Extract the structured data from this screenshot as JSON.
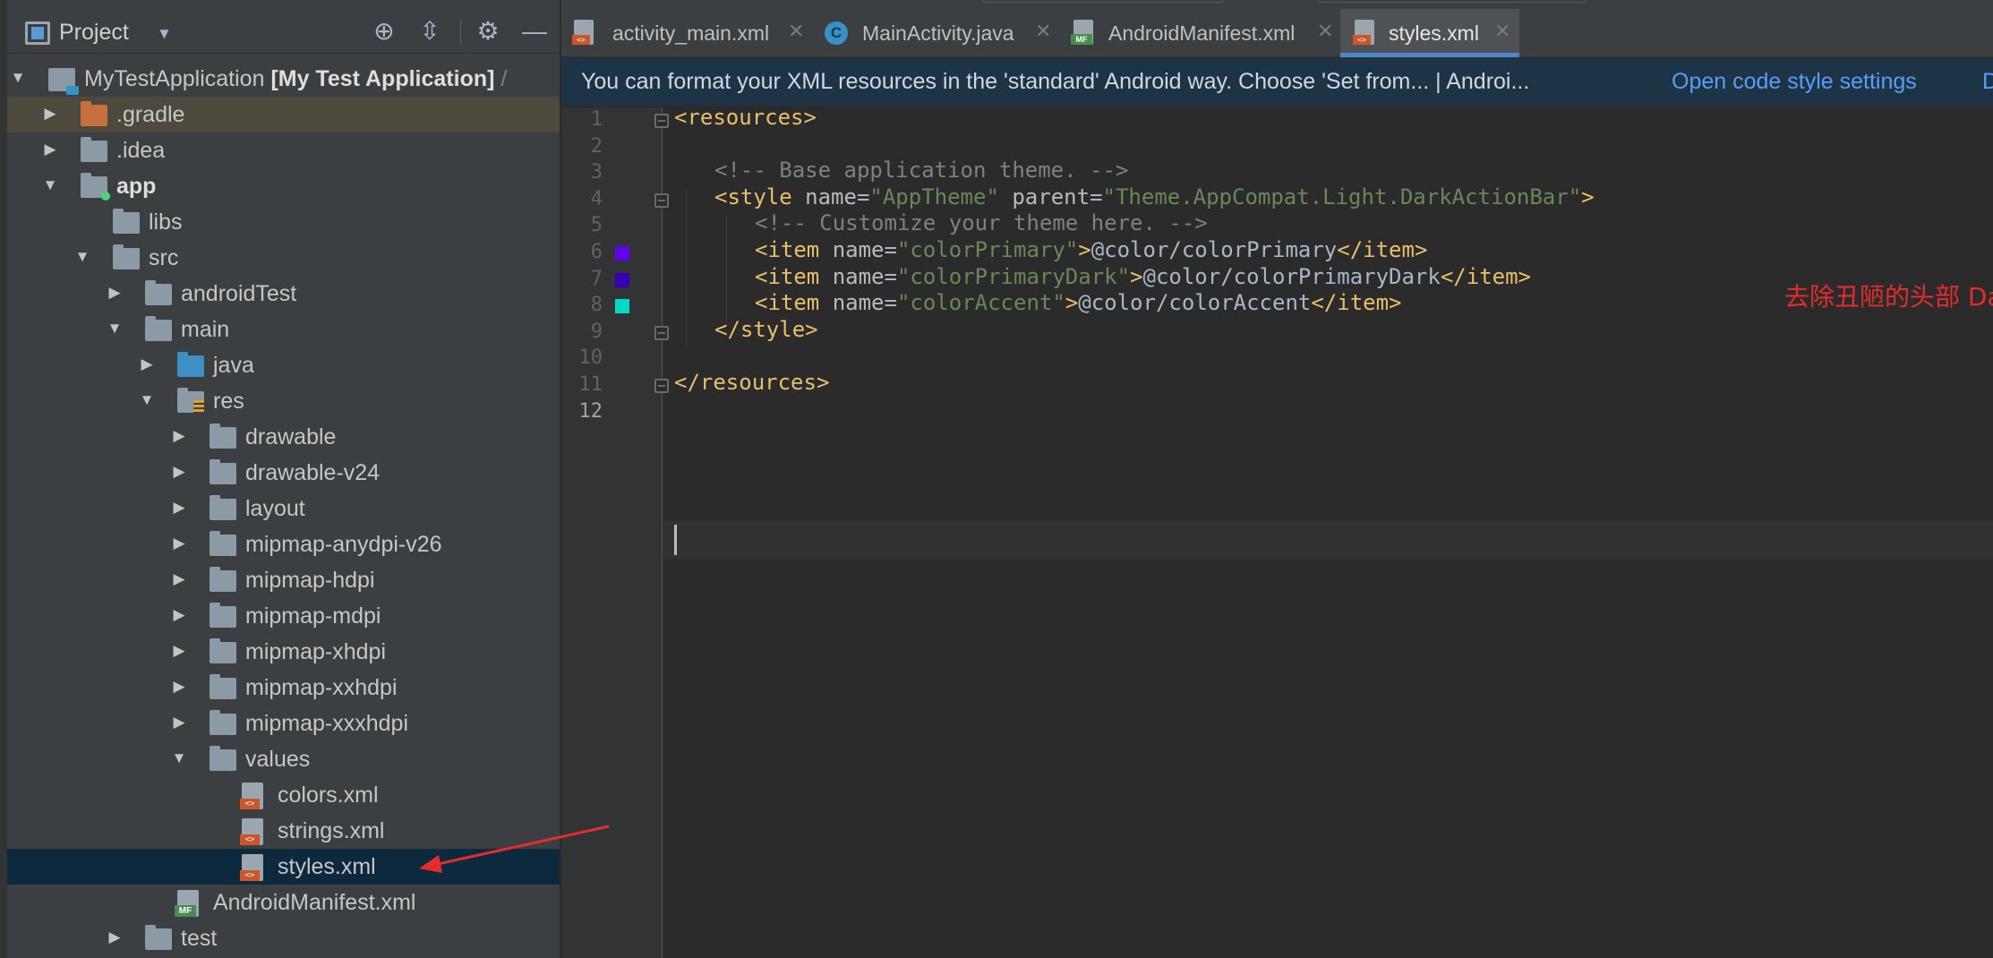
{
  "project_panel": {
    "title": "Project",
    "icons": [
      "locate-icon",
      "collapse-icon",
      "gear-icon",
      "minimize-icon"
    ]
  },
  "tree": [
    {
      "label": "MyTestApplication",
      "extra": "[My Test Application]",
      "suffix": "/",
      "type": "module",
      "indent": 0,
      "expanded": true
    },
    {
      "label": ".gradle",
      "type": "folder-orange",
      "indent": 1,
      "expanded": false
    },
    {
      "label": ".idea",
      "type": "folder",
      "indent": 1,
      "expanded": false
    },
    {
      "label": "app",
      "type": "folder-app",
      "indent": 1,
      "expanded": true
    },
    {
      "label": "libs",
      "type": "folder",
      "indent": 2
    },
    {
      "label": "src",
      "type": "folder",
      "indent": 2,
      "expanded": true
    },
    {
      "label": "androidTest",
      "type": "folder",
      "indent": 3,
      "expanded": false
    },
    {
      "label": "main",
      "type": "folder",
      "indent": 3,
      "expanded": true
    },
    {
      "label": "java",
      "type": "folder-blue",
      "indent": 4,
      "expanded": false
    },
    {
      "label": "res",
      "type": "folder-res",
      "indent": 4,
      "expanded": true
    },
    {
      "label": "drawable",
      "type": "folder",
      "indent": 5,
      "expanded": false
    },
    {
      "label": "drawable-v24",
      "type": "folder",
      "indent": 5,
      "expanded": false
    },
    {
      "label": "layout",
      "type": "folder",
      "indent": 5,
      "expanded": false
    },
    {
      "label": "mipmap-anydpi-v26",
      "type": "folder",
      "indent": 5,
      "expanded": false
    },
    {
      "label": "mipmap-hdpi",
      "type": "folder",
      "indent": 5,
      "expanded": false
    },
    {
      "label": "mipmap-mdpi",
      "type": "folder",
      "indent": 5,
      "expanded": false
    },
    {
      "label": "mipmap-xhdpi",
      "type": "folder",
      "indent": 5,
      "expanded": false
    },
    {
      "label": "mipmap-xxhdpi",
      "type": "folder",
      "indent": 5,
      "expanded": false
    },
    {
      "label": "mipmap-xxxhdpi",
      "type": "folder",
      "indent": 5,
      "expanded": false
    },
    {
      "label": "values",
      "type": "folder",
      "indent": 5,
      "expanded": true
    },
    {
      "label": "colors.xml",
      "type": "xml",
      "indent": 6
    },
    {
      "label": "strings.xml",
      "type": "xml",
      "indent": 6
    },
    {
      "label": "styles.xml",
      "type": "xml",
      "indent": 6,
      "selected": true
    },
    {
      "label": "AndroidManifest.xml",
      "type": "manifest",
      "indent": 4
    },
    {
      "label": "test",
      "type": "folder",
      "indent": 3,
      "expanded": false
    }
  ],
  "tabs": [
    {
      "label": "activity_main.xml",
      "icon": "xml-file-icon"
    },
    {
      "label": "MainActivity.java",
      "icon": "java-class-icon",
      "icon_text": "C"
    },
    {
      "label": "AndroidManifest.xml",
      "icon": "manifest-file-icon"
    },
    {
      "label": "styles.xml",
      "icon": "xml-file-icon",
      "active": true
    }
  ],
  "tab_close": "✕",
  "banner": {
    "message": "You can format your XML resources in the 'standard' Android way. Choose 'Set from... | Androi...",
    "link": "Open code style settings",
    "link2": "D"
  },
  "editor": {
    "current_line": 12,
    "lines": [
      {
        "n": "1",
        "parts": [
          [
            "br",
            "<"
          ],
          [
            "tag",
            "resources"
          ],
          [
            "br",
            ">"
          ]
        ],
        "indent": 0,
        "fold": true
      },
      {
        "n": "2",
        "parts": [],
        "indent": 0
      },
      {
        "n": "3",
        "parts": [
          [
            "cmt",
            "<!-- Base application theme. -->"
          ]
        ],
        "indent": 1
      },
      {
        "n": "4",
        "parts": [
          [
            "br",
            "<"
          ],
          [
            "tag",
            "style "
          ],
          [
            "attr",
            "name"
          ],
          [
            "plain",
            "="
          ],
          [
            "val",
            "\"AppTheme\" "
          ],
          [
            "attr",
            "parent"
          ],
          [
            "plain",
            "="
          ],
          [
            "val",
            "\"Theme.AppCompat.Light.DarkActionBar\""
          ],
          [
            "br",
            ">"
          ]
        ],
        "indent": 1,
        "fold": true
      },
      {
        "n": "5",
        "parts": [
          [
            "cmt",
            "<!-- Customize your theme here. -->"
          ]
        ],
        "indent": 2
      },
      {
        "n": "6",
        "parts": [
          [
            "br",
            "<"
          ],
          [
            "tag",
            "item "
          ],
          [
            "attr",
            "name"
          ],
          [
            "plain",
            "="
          ],
          [
            "val",
            "\"colorPrimary\""
          ],
          [
            "br",
            ">"
          ],
          [
            "plain",
            "@color/colorPrimary"
          ],
          [
            "br",
            "</"
          ],
          [
            "tag",
            "item"
          ],
          [
            "br",
            ">"
          ]
        ],
        "indent": 2,
        "swatch": "#6200ee"
      },
      {
        "n": "7",
        "parts": [
          [
            "br",
            "<"
          ],
          [
            "tag",
            "item "
          ],
          [
            "attr",
            "name"
          ],
          [
            "plain",
            "="
          ],
          [
            "val",
            "\"colorPrimaryDark\""
          ],
          [
            "br",
            ">"
          ],
          [
            "plain",
            "@color/colorPrimaryDark"
          ],
          [
            "br",
            "</"
          ],
          [
            "tag",
            "item"
          ],
          [
            "br",
            ">"
          ]
        ],
        "indent": 2,
        "swatch": "#3700b3"
      },
      {
        "n": "8",
        "parts": [
          [
            "br",
            "<"
          ],
          [
            "tag",
            "item "
          ],
          [
            "attr",
            "name"
          ],
          [
            "plain",
            "="
          ],
          [
            "val",
            "\"colorAccent\""
          ],
          [
            "br",
            ">"
          ],
          [
            "plain",
            "@color/colorAccent"
          ],
          [
            "br",
            "</"
          ],
          [
            "tag",
            "item"
          ],
          [
            "br",
            ">"
          ]
        ],
        "indent": 2,
        "swatch": "#03dac5"
      },
      {
        "n": "9",
        "parts": [
          [
            "br",
            "</"
          ],
          [
            "tag",
            "style"
          ],
          [
            "br",
            ">"
          ]
        ],
        "indent": 1,
        "fold": true
      },
      {
        "n": "10",
        "parts": [],
        "indent": 0
      },
      {
        "n": "11",
        "parts": [
          [
            "br",
            "</"
          ],
          [
            "tag",
            "resources"
          ],
          [
            "br",
            ">"
          ]
        ],
        "indent": 0,
        "fold": true
      },
      {
        "n": "12",
        "parts": [],
        "indent": 0
      }
    ]
  },
  "annotation": {
    "text": "去除丑陋的头部 DarkActionBar修改成NoActionBar",
    "color": "#e42c2c"
  },
  "colors": {
    "accent": "#4a88c7",
    "selection": "#0d293e",
    "link": "#589df6"
  }
}
